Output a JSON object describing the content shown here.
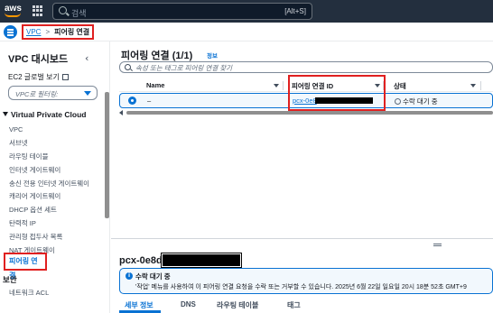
{
  "topnav": {
    "logo": "aws",
    "search_placeholder": "검색",
    "search_shortcut": "[Alt+S]"
  },
  "breadcrumb": {
    "root": "VPC",
    "separator": ">",
    "current": "피어링 연결"
  },
  "sidebar": {
    "title": "VPC 대시보드",
    "ec2_link": "EC2 글로벌 보기",
    "filter_placeholder": "VPC로 필터링:",
    "section_title": "Virtual Private Cloud",
    "items": [
      {
        "label": "VPC"
      },
      {
        "label": "서브넷"
      },
      {
        "label": "라우팅 테이블"
      },
      {
        "label": "인터넷 게이트웨이"
      },
      {
        "label": "송신 전용 인터넷 게이트웨이"
      },
      {
        "label": "캐리어 게이트웨이"
      },
      {
        "label": "DHCP 옵션 세트"
      },
      {
        "label": "탄력적 IP"
      },
      {
        "label": "관리형 접두사 목록"
      },
      {
        "label": "NAT 게이트웨이"
      }
    ],
    "active_item": "피어링 연결",
    "section2_title": "보안",
    "last_item": "네트워크 ACL"
  },
  "panel": {
    "title": "피어링 연결",
    "count": "(1/1)",
    "info": "정보",
    "search_placeholder": "속성 또는 태그로 피어링 연결 찾기",
    "columns": [
      "Name",
      "피어링 연결 ID",
      "상태"
    ],
    "rows": [
      {
        "name": "–",
        "id": "pcx-0e8",
        "status": "수락 대기 중"
      }
    ]
  },
  "detail": {
    "title": "pcx-0e8d",
    "flash_title": "수락 대기 중",
    "flash_body": "'작업' 메뉴를 사용하여 이 피어링 연결 요청을 수락 또는 거부할 수 있습니다. 2025년 6월 22일 일요일 20시 18분 52초 GMT+9",
    "tabs": [
      "세부 정보",
      "DNS",
      "라우팅 테이블",
      "태그"
    ]
  },
  "colors": {
    "nav_bg": "#232f3e",
    "accent": "#0972d3",
    "highlight_box": "#e02020",
    "aws_orange": "#ff9900"
  }
}
